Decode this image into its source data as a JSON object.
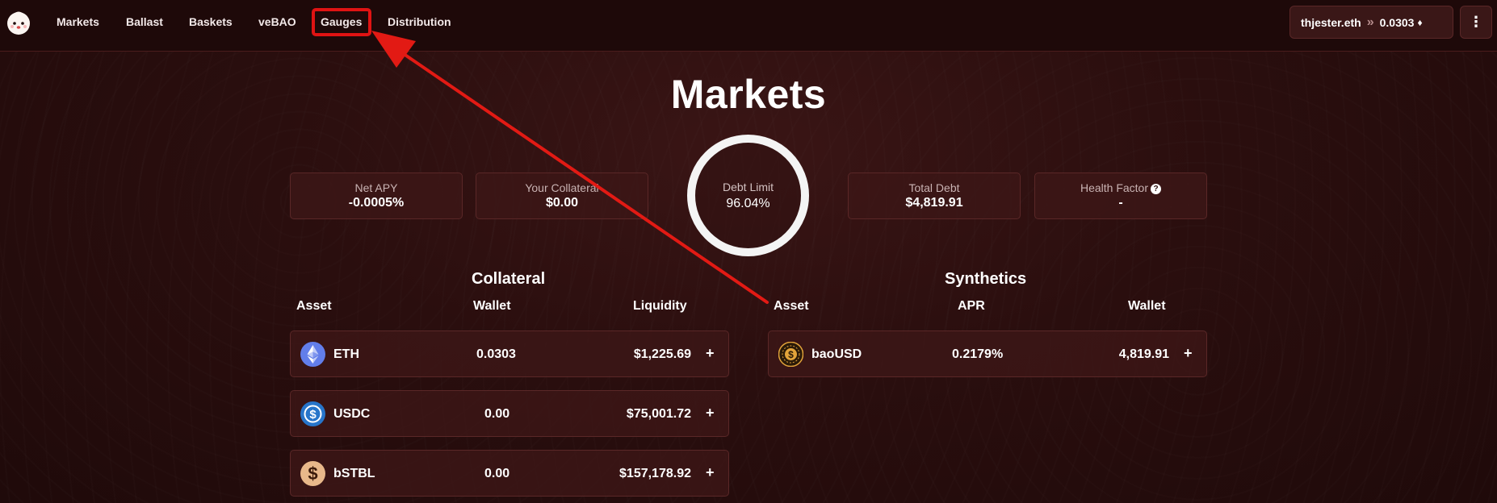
{
  "nav": {
    "logo_icon": "bao-bun-logo-icon",
    "links": [
      "Markets",
      "Ballast",
      "Baskets",
      "veBAO",
      "Gauges",
      "Distribution"
    ],
    "account": {
      "name": "thjester.eth",
      "separator": "»",
      "balance": "0.0303",
      "currency_icon": "eth-icon",
      "currency_glyph": "♦"
    },
    "menu_glyph": "⋮",
    "highlight_color": "#e01313"
  },
  "page": {
    "title": "Markets"
  },
  "stats": {
    "net_apy": {
      "label": "Net APY",
      "value": "-0.0005%"
    },
    "collateral": {
      "label": "Your Collateral",
      "value": "$0.00"
    },
    "debt_limit": {
      "label": "Debt Limit",
      "value": "96.04%"
    },
    "total_debt": {
      "label": "Total Debt",
      "value": "$4,819.91"
    },
    "health_factor": {
      "label": "Health Factor",
      "value": "-",
      "help_glyph": "?"
    }
  },
  "collateral": {
    "title": "Collateral",
    "headers": [
      "Asset",
      "Wallet",
      "Liquidity"
    ],
    "rows": [
      {
        "icon": "eth-icon",
        "asset": "ETH",
        "wallet": "0.0303",
        "liquidity": "$1,225.69",
        "action": "+"
      },
      {
        "icon": "usdc-icon",
        "asset": "USDC",
        "wallet": "0.00",
        "liquidity": "$75,001.72",
        "action": "+"
      },
      {
        "icon": "bstbl-icon",
        "asset": "bSTBL",
        "wallet": "0.00",
        "liquidity": "$157,178.92",
        "action": "+"
      }
    ]
  },
  "synthetics": {
    "title": "Synthetics",
    "headers": [
      "Asset",
      "APR",
      "Wallet"
    ],
    "rows": [
      {
        "icon": "baousd-icon",
        "asset": "baoUSD",
        "apr": "0.2179%",
        "wallet": "4,819.91",
        "action": "+"
      }
    ]
  },
  "annotation": {
    "color": "#e21a14"
  }
}
